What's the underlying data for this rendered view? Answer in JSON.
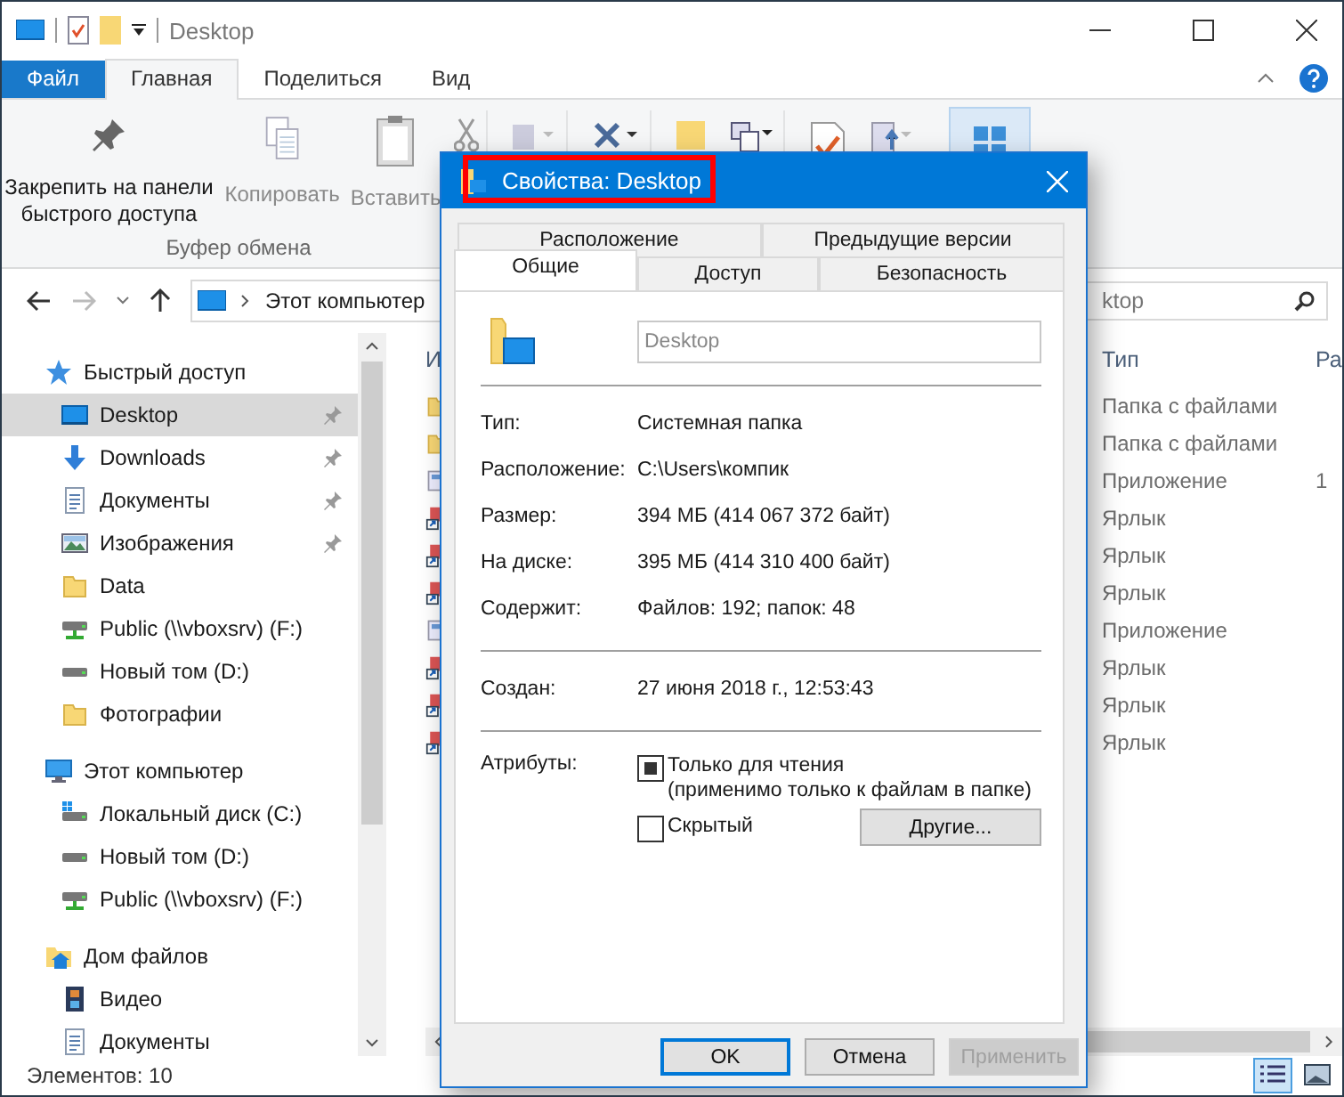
{
  "window": {
    "title": "Desktop"
  },
  "ribbon_tabs": [
    {
      "label": "Файл",
      "kind": "file",
      "selected": false
    },
    {
      "label": "Главная",
      "kind": "tab",
      "selected": true
    },
    {
      "label": "Поделиться",
      "kind": "tab",
      "selected": false
    },
    {
      "label": "Вид",
      "kind": "tab",
      "selected": false
    }
  ],
  "ribbon": {
    "group_label": "Буфер обмена",
    "buttons": [
      {
        "label": "Закрепить на панели быстрого доступа",
        "kind": "pin",
        "disabled": false
      },
      {
        "label": "Копировать",
        "kind": "copy",
        "disabled": true
      },
      {
        "label": "Вставить",
        "kind": "paste",
        "disabled": true
      }
    ]
  },
  "address": {
    "path": "Этот компьютер",
    "search": "ktop"
  },
  "nav": [
    {
      "label": "Быстрый доступ",
      "kind": "star",
      "children": [
        {
          "label": "Desktop",
          "kind": "desktop",
          "pinned": true,
          "selected": true
        },
        {
          "label": "Downloads",
          "kind": "download",
          "pinned": true,
          "selected": false
        },
        {
          "label": "Документы",
          "kind": "document",
          "pinned": true,
          "selected": false
        },
        {
          "label": "Изображения",
          "kind": "image",
          "pinned": true,
          "selected": false
        },
        {
          "label": "Data",
          "kind": "folder",
          "pinned": false,
          "selected": false
        },
        {
          "label": "Public (\\\\vboxsrv) (F:)",
          "kind": "netdrive",
          "pinned": false,
          "selected": false
        },
        {
          "label": "Новый том (D:)",
          "kind": "drive",
          "pinned": false,
          "selected": false
        },
        {
          "label": "Фотографии",
          "kind": "folder",
          "pinned": false,
          "selected": false
        }
      ]
    },
    {
      "label": "Этот компьютер",
      "kind": "pc",
      "children": [
        {
          "label": "Локальный диск (C:)",
          "kind": "windrive",
          "pinned": false,
          "selected": false
        },
        {
          "label": "Новый том (D:)",
          "kind": "drive",
          "pinned": false,
          "selected": false
        },
        {
          "label": "Public (\\\\vboxsrv) (F:)",
          "kind": "netdrive",
          "pinned": false,
          "selected": false
        }
      ]
    },
    {
      "label": "Дом файлов",
      "kind": "homegroup",
      "children": [
        {
          "label": "Видео",
          "kind": "video",
          "pinned": false,
          "selected": false
        },
        {
          "label": "Документы",
          "kind": "document",
          "pinned": false,
          "selected": false
        }
      ]
    }
  ],
  "file_list": {
    "columns": [
      "И",
      "Тип",
      "Ра"
    ],
    "rows": [
      {
        "kind": "folder",
        "type": "Папка с файлами"
      },
      {
        "kind": "folder",
        "type": "Папка с файлами"
      },
      {
        "kind": "app",
        "type": "Приложение",
        "size": "1"
      },
      {
        "kind": "shortcut",
        "type": "Ярлык"
      },
      {
        "kind": "shortcut",
        "type": "Ярлык"
      },
      {
        "kind": "shortcut",
        "type": "Ярлык"
      },
      {
        "kind": "app",
        "type": "Приложение"
      },
      {
        "kind": "shortcut",
        "type": "Ярлык"
      },
      {
        "kind": "shortcut",
        "type": "Ярлык"
      },
      {
        "kind": "shortcut",
        "type": "Ярлык"
      }
    ]
  },
  "status_bar": {
    "count": "Элементов: 10"
  },
  "dialog": {
    "title": "Свойства: Desktop",
    "highlighted": true,
    "tabs_back": [
      {
        "label": "Расположение",
        "selected": false
      },
      {
        "label": "Предыдущие версии",
        "selected": false
      }
    ],
    "tabs_front": [
      {
        "label": "Общие",
        "selected": true
      },
      {
        "label": "Доступ",
        "selected": false
      },
      {
        "label": "Безопасность",
        "selected": false
      }
    ],
    "name": "Desktop",
    "props": [
      {
        "label": "Тип:",
        "value": "Системная папка"
      },
      {
        "label": "Расположение:",
        "value": "C:\\Users\\компик"
      },
      {
        "label": "Размер:",
        "value": "394 МБ (414 067 372 байт)"
      },
      {
        "label": "На диске:",
        "value": "395 МБ (414 310 400 байт)"
      },
      {
        "label": "Содержит:",
        "value": "Файлов: 192; папок: 48"
      }
    ],
    "created": {
      "label": "Создан:",
      "value": "27 июня 2018 г., 12:53:43"
    },
    "attributes_label": "Атрибуты:",
    "attributes": [
      {
        "label": "Только для чтения",
        "note": "(применимо только к файлам в папке)",
        "checked": false,
        "indeterminate": true
      },
      {
        "label": "Скрытый",
        "checked": false,
        "indeterminate": false
      }
    ],
    "advanced_button": "Другие...",
    "buttons": [
      {
        "label": "OK",
        "kind": "default",
        "disabled": false
      },
      {
        "label": "Отмена",
        "kind": "normal",
        "disabled": false
      },
      {
        "label": "Применить",
        "kind": "normal",
        "disabled": true
      }
    ]
  }
}
